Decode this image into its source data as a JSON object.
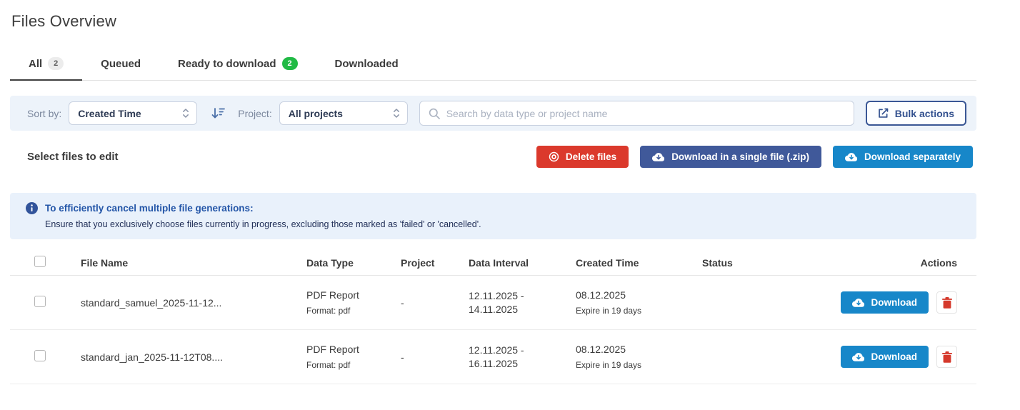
{
  "page": {
    "title": "Files Overview"
  },
  "tabs": [
    {
      "label": "All",
      "badge": "2"
    },
    {
      "label": "Queued"
    },
    {
      "label": "Ready to download",
      "badge": "2"
    },
    {
      "label": "Downloaded"
    }
  ],
  "filter_bar": {
    "sort_by_label": "Sort by:",
    "sort_by_value": "Created Time",
    "project_label": "Project:",
    "project_value": "All projects",
    "search_placeholder": "Search by data type or project name",
    "bulk_actions_label": "Bulk actions"
  },
  "selection": {
    "title": "Select files to edit",
    "delete_label": "Delete files",
    "download_zip_label": "Download in a single file (.zip)",
    "download_separately_label": "Download separately"
  },
  "info_banner": {
    "title": "To efficiently cancel multiple file generations:",
    "body": "Ensure that you exclusively choose files currently in progress, excluding those marked as 'failed' or 'cancelled'."
  },
  "table": {
    "headers": [
      "File Name",
      "Data Type",
      "Project",
      "Data Interval",
      "Created Time",
      "Status",
      "Actions"
    ],
    "rows": [
      {
        "file_name": "standard_samuel_2025-11-12...",
        "data_type": "PDF Report",
        "format": "Format: pdf",
        "project": "-",
        "interval_line1": "12.11.2025 -",
        "interval_line2": "14.11.2025",
        "created": "08.12.2025",
        "expires": "Expire in 19 days",
        "status": "",
        "download_label": "Download"
      },
      {
        "file_name": "standard_jan_2025-11-12T08....",
        "data_type": "PDF Report",
        "format": "Format: pdf",
        "project": "-",
        "interval_line1": "12.11.2025 -",
        "interval_line2": "16.11.2025",
        "created": "08.12.2025",
        "expires": "Expire in 19 days",
        "status": "",
        "download_label": "Download"
      }
    ]
  },
  "colors": {
    "primary_blue": "#1787c9",
    "navy": "#40599a",
    "red": "#db392c",
    "green_badge": "#21ba45",
    "gray_badge": "#ececec",
    "filter_bar_bg": "#edf3fa",
    "banner_bg": "#e9f1fb",
    "banner_title_blue": "#2456a8",
    "bulk_border_blue": "#3a5795"
  }
}
